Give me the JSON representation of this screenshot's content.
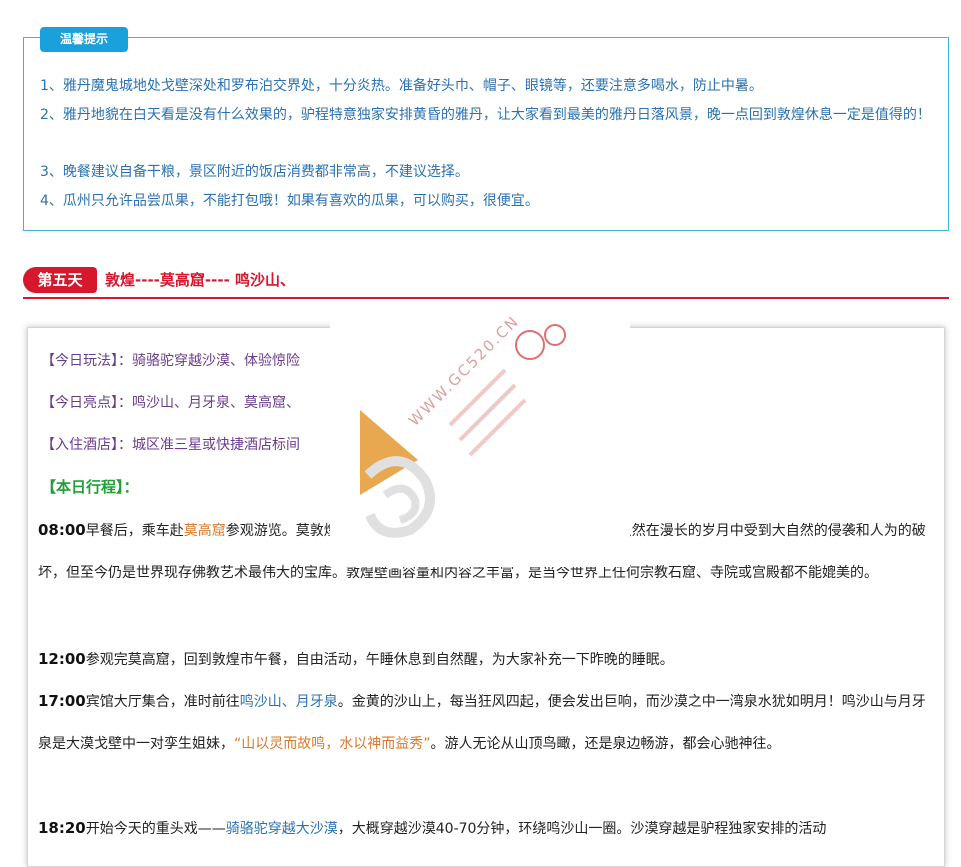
{
  "tips": {
    "label": "温馨提示",
    "items": [
      "1、雅丹魔鬼城地处戈壁深处和罗布泊交界处，十分炎热。准备好头巾、帽子、眼镜等，还要注意多喝水，防止中暑。",
      "2、雅丹地貌在白天看是没有什么效果的，驴程特意独家安排黄昏的雅丹，让大家看到最美的雅丹日落风景，晚一点回到敦煌休息一定是值得的！",
      "3、晚餐建议自备干粮，景区附近的饭店消费都非常高，不建议选择。",
      "4、瓜州只允许品尝瓜果，不能打包哦！如果有喜欢的瓜果，可以购买，很便宜。"
    ]
  },
  "day": {
    "badge": "第五天",
    "title": "敦煌----莫高窟---- 鸣沙山、"
  },
  "card": {
    "play": "【今日玩法】：骑骆驼穿越沙漠、体验惊险",
    "highlights": "【今日亮点】：鸣沙山、月牙泉、莫高窟、",
    "hotel": "【入住酒店】：城区准三星或快捷酒店标间",
    "plan_heading": "【本日行程】：",
    "p1": {
      "time": "08:00",
      "a": "早餐后，乘车赴",
      "link": "莫高窟",
      "b": "参观游览。莫",
      "c": "虽然在漫长的岁月中受到大自然的侵袭和人为的破坏，但至今仍是世界现存佛教艺术最伟大的宝库。敦煌壁画容量和内容之丰富，是当今世界上任何宗教石窟、寺院或宫殿都不能媲美的。"
    },
    "p2": {
      "time": "12:00",
      "text": "参观完莫高窟，回到敦煌市午餐，自由活动，午睡休息到自然醒，为大家补充一下昨晚的睡眠。"
    },
    "p3": {
      "time": "17:00",
      "a": "宾馆大厅集合，准时前往",
      "link": "鸣沙山、月牙泉",
      "b": "。金黄的沙山上，每当狂风四起，便会发出巨响，而沙漠之中一湾泉水犹如明月！鸣沙山与月牙泉是大漠戈壁中一对孪生姐妹，",
      "quote": "“山以灵而故鸣，水以神而益秀”",
      "c": "。游人无论从山顶鸟瞰，还是泉边畅游，都会心驰神往。"
    },
    "p4": {
      "time": "18:20",
      "a": "开始今天的重头戏——",
      "link": "骑骆驼穿越大沙漠",
      "b": "，大概穿越沙漠40-70分钟，环绕鸣沙山一圈。沙漠穿越是驴程独家安排的活动"
    }
  },
  "watermark": {
    "text": "WWW.GC520.CN",
    "accent_color": "#e8a850",
    "text_color": "#d55050"
  }
}
